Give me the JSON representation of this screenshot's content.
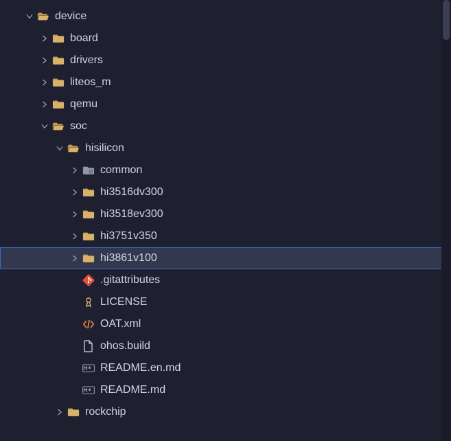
{
  "tree": [
    {
      "indent": 1,
      "expandable": true,
      "expanded": true,
      "icon": "folder-open",
      "label": "device",
      "selected": false
    },
    {
      "indent": 2,
      "expandable": true,
      "expanded": false,
      "icon": "folder",
      "label": "board",
      "selected": false
    },
    {
      "indent": 2,
      "expandable": true,
      "expanded": false,
      "icon": "folder",
      "label": "drivers",
      "selected": false
    },
    {
      "indent": 2,
      "expandable": true,
      "expanded": false,
      "icon": "folder",
      "label": "liteos_m",
      "selected": false
    },
    {
      "indent": 2,
      "expandable": true,
      "expanded": false,
      "icon": "folder",
      "label": "qemu",
      "selected": false
    },
    {
      "indent": 2,
      "expandable": true,
      "expanded": true,
      "icon": "folder-open",
      "label": "soc",
      "selected": false
    },
    {
      "indent": 3,
      "expandable": true,
      "expanded": true,
      "icon": "folder-open",
      "label": "hisilicon",
      "selected": false
    },
    {
      "indent": 4,
      "expandable": true,
      "expanded": false,
      "icon": "folder-special",
      "label": "common",
      "selected": false
    },
    {
      "indent": 4,
      "expandable": true,
      "expanded": false,
      "icon": "folder",
      "label": "hi3516dv300",
      "selected": false
    },
    {
      "indent": 4,
      "expandable": true,
      "expanded": false,
      "icon": "folder",
      "label": "hi3518ev300",
      "selected": false
    },
    {
      "indent": 4,
      "expandable": true,
      "expanded": false,
      "icon": "folder",
      "label": "hi3751v350",
      "selected": false
    },
    {
      "indent": 4,
      "expandable": true,
      "expanded": false,
      "icon": "folder",
      "label": "hi3861v100",
      "selected": true
    },
    {
      "indent": 4,
      "expandable": false,
      "expanded": false,
      "icon": "git",
      "label": ".gitattributes",
      "selected": false
    },
    {
      "indent": 4,
      "expandable": false,
      "expanded": false,
      "icon": "license",
      "label": "LICENSE",
      "selected": false
    },
    {
      "indent": 4,
      "expandable": false,
      "expanded": false,
      "icon": "xml",
      "label": "OAT.xml",
      "selected": false
    },
    {
      "indent": 4,
      "expandable": false,
      "expanded": false,
      "icon": "file",
      "label": "ohos.build",
      "selected": false
    },
    {
      "indent": 4,
      "expandable": false,
      "expanded": false,
      "icon": "md",
      "label": "README.en.md",
      "selected": false
    },
    {
      "indent": 4,
      "expandable": false,
      "expanded": false,
      "icon": "md",
      "label": "README.md",
      "selected": false
    },
    {
      "indent": 3,
      "expandable": true,
      "expanded": false,
      "icon": "folder",
      "label": "rockchip",
      "selected": false
    }
  ],
  "icons": {
    "chevron-right": "chevron-right",
    "chevron-down": "chevron-down"
  }
}
